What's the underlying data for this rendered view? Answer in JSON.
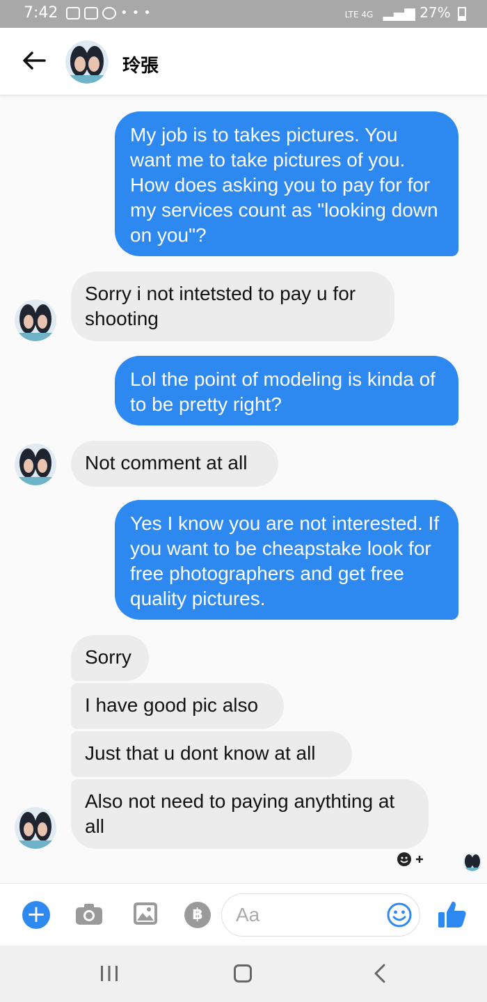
{
  "status_bar": {
    "time": "7:42",
    "battery": "27%",
    "network": "LTE 4G",
    "icons": [
      "gallery-icon",
      "instagram-icon",
      "whatsapp-icon",
      "more-dots-icon",
      "volte-icon",
      "signal-icon",
      "battery-icon"
    ]
  },
  "header": {
    "contact_name": "玲張",
    "back_icon": "back-arrow-icon"
  },
  "messages": [
    {
      "direction": "out",
      "text": "My job is to takes pictures. You want me to take pictures of you. How does asking you to pay for for my services count as \"looking down on you\"?"
    },
    {
      "direction": "in",
      "text": "Sorry i not intetsted to pay u for shooting"
    },
    {
      "direction": "out",
      "text": "Lol the point of modeling is kinda of to be pretty right?"
    },
    {
      "direction": "in",
      "text": "Not comment at all"
    },
    {
      "direction": "out",
      "text": "Yes I know you are not interested. If you want to be cheapstake look for free photographers and get free quality pictures."
    },
    {
      "direction": "in",
      "text": "Sorry"
    },
    {
      "direction": "in",
      "text": "I have good pic also"
    },
    {
      "direction": "in",
      "text": "Just that u dont know at all"
    },
    {
      "direction": "in",
      "text": "Also not need to paying anythting at all"
    }
  ],
  "reaction_icon": "add-reaction-icon",
  "composer": {
    "placeholder": "Aa",
    "icons": [
      "plus-icon",
      "camera-icon",
      "gallery-icon",
      "coin-icon",
      "emoji-icon",
      "thumbs-up-icon"
    ]
  },
  "nav_bar": {
    "icons": [
      "recents-icon",
      "home-icon",
      "back-icon"
    ]
  },
  "colors": {
    "accent": "#2d88ef",
    "incoming_bubble": "#ececec",
    "status_bar": "#a8a8a8"
  }
}
